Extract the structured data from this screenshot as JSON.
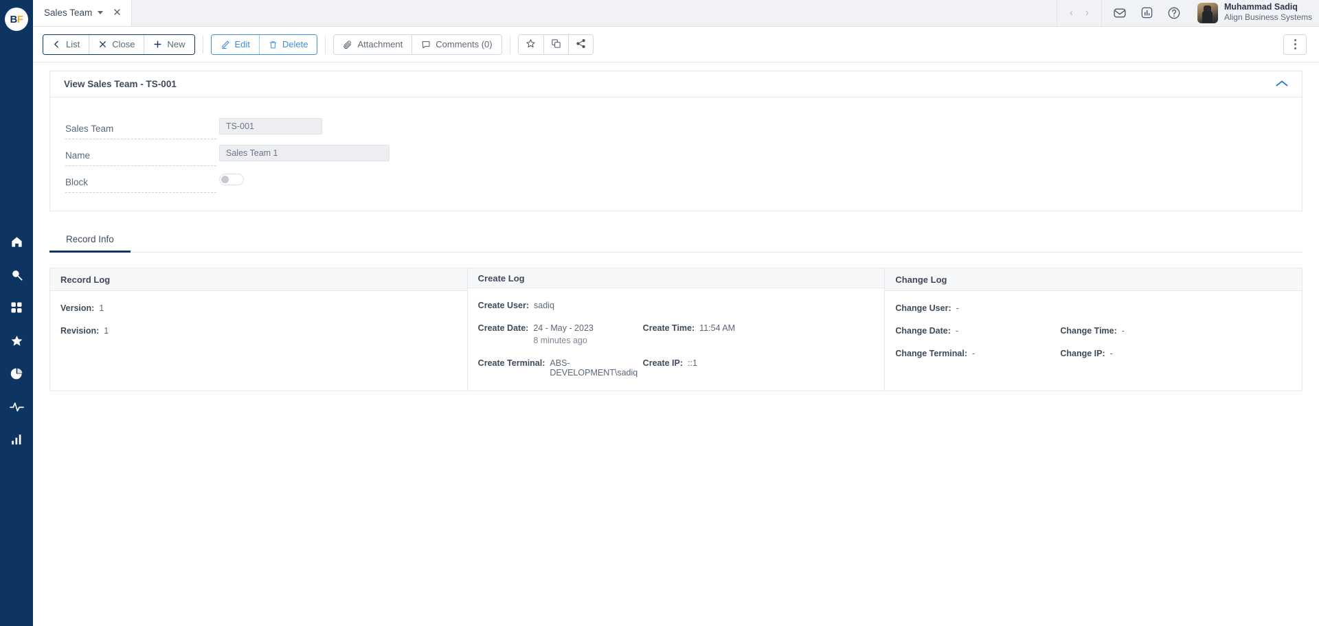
{
  "brand": {
    "logo_text_1": "B",
    "logo_text_2": "F",
    "accent": "#0e3461",
    "gold": "#f5a623"
  },
  "tab": {
    "label": "Sales Team",
    "close": "✕"
  },
  "topbar": {
    "nav_prev": "‹",
    "nav_next": "›",
    "icons": [
      "mail-icon",
      "report-icon",
      "help-icon"
    ],
    "user_name": "Muhammad Sadiq",
    "user_org": "Align Business Systems"
  },
  "toolbar": {
    "list_label": "List",
    "close_label": "Close",
    "new_label": "New",
    "edit_label": "Edit",
    "delete_label": "Delete",
    "attachment_label": "Attachment",
    "comments_label": "Comments (0)",
    "icons": [
      "star-icon",
      "duplicate-icon",
      "share-icon"
    ],
    "more_label": "⋮"
  },
  "form_card": {
    "title": "View Sales Team - TS-001",
    "fields": [
      {
        "label": "Sales Team",
        "value": "TS-001",
        "type": "text",
        "size": "sm"
      },
      {
        "label": "Name",
        "value": "Sales Team 1",
        "type": "text",
        "size": "lg"
      },
      {
        "label": "Block",
        "value": "",
        "type": "toggle",
        "checked": false
      }
    ]
  },
  "tabs": [
    {
      "label": "Record Info",
      "active": true
    }
  ],
  "logs": {
    "record_log": {
      "title": "Record Log",
      "rows": [
        {
          "key": "Version:",
          "value": "1"
        },
        {
          "key": "Revision:",
          "value": "1"
        }
      ]
    },
    "create_log": {
      "title": "Create Log",
      "user_key": "Create User:",
      "user_value": "sadiq",
      "date_key": "Create Date:",
      "date_value": "24 - May - 2023",
      "date_sub": "8 minutes ago",
      "time_key": "Create Time:",
      "time_value": "11:54 AM",
      "terminal_key": "Create Terminal:",
      "terminal_value": "ABS-DEVELOPMENT\\sadiq",
      "ip_key": "Create IP:",
      "ip_value": "::1"
    },
    "change_log": {
      "title": "Change Log",
      "user_key": "Change User:",
      "user_value": "-",
      "date_key": "Change Date:",
      "date_value": "-",
      "time_key": "Change Time:",
      "time_value": "-",
      "terminal_key": "Change Terminal:",
      "terminal_value": "-",
      "ip_key": "Change IP:",
      "ip_value": "-"
    }
  },
  "sidebar": {
    "items": [
      {
        "icon": "home-icon",
        "name": "sidebar-item-home"
      },
      {
        "icon": "search-icon",
        "name": "sidebar-item-search"
      },
      {
        "icon": "apps-grid-icon",
        "name": "sidebar-item-apps"
      },
      {
        "icon": "star-icon",
        "name": "sidebar-item-favorites"
      },
      {
        "icon": "pie-chart-icon",
        "name": "sidebar-item-analytics"
      },
      {
        "icon": "activity-pulse-icon",
        "name": "sidebar-item-activity"
      },
      {
        "icon": "bar-chart-icon",
        "name": "sidebar-item-reports"
      }
    ]
  }
}
